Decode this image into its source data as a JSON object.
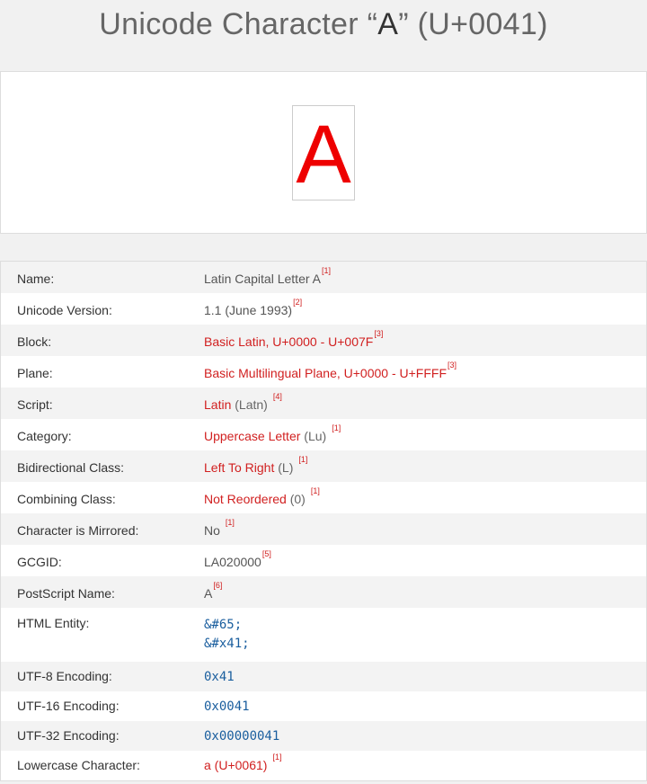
{
  "header": {
    "title_prefix": "Unicode Character “",
    "title_char": "A",
    "title_suffix": "” (U+0041)"
  },
  "preview": {
    "glyph": "A",
    "glyph_color": "#e00000"
  },
  "details": {
    "name": {
      "label": "Name:",
      "value": "Latin Capital Letter A",
      "ref": "[1]"
    },
    "unicode_version": {
      "label": "Unicode Version:",
      "value": "1.1 (June 1993)",
      "ref": "[2]"
    },
    "block": {
      "label": "Block:",
      "value": "Basic Latin, U+0000 - U+007F",
      "ref": "[3]"
    },
    "plane": {
      "label": "Plane:",
      "value": "Basic Multilingual Plane, U+0000 - U+FFFF",
      "ref": "[3]"
    },
    "script": {
      "label": "Script:",
      "value": "Latin",
      "paren": "(Latn)",
      "ref": "[4]"
    },
    "category": {
      "label": "Category:",
      "value": "Uppercase Letter",
      "paren": "(Lu)",
      "ref": "[1]"
    },
    "bidi": {
      "label": "Bidirectional Class:",
      "value": "Left To Right",
      "paren": "(L)",
      "ref": "[1]"
    },
    "combining": {
      "label": "Combining Class:",
      "value": "Not Reordered",
      "paren": "(0)",
      "ref": "[1]"
    },
    "mirrored": {
      "label": "Character is Mirrored:",
      "value": "No",
      "ref": "[1]"
    },
    "gcgid": {
      "label": "GCGID:",
      "value": "LA020000",
      "ref": "[5]"
    },
    "postscript": {
      "label": "PostScript Name:",
      "value": "A",
      "ref": "[6]"
    },
    "html_entity": {
      "label": "HTML Entity:",
      "values": [
        "&#65;",
        "&#x41;"
      ]
    },
    "utf8": {
      "label": "UTF-8 Encoding:",
      "value": "0x41"
    },
    "utf16": {
      "label": "UTF-16 Encoding:",
      "value": "0x0041"
    },
    "utf32": {
      "label": "UTF-32 Encoding:",
      "value": "0x00000041"
    },
    "lowercase": {
      "label": "Lowercase Character:",
      "value": "a (U+0061)",
      "ref": "[1]"
    }
  },
  "colors": {
    "link": "#d12020",
    "code": "#1a5e9e",
    "stripe": "#f3f3f3"
  }
}
